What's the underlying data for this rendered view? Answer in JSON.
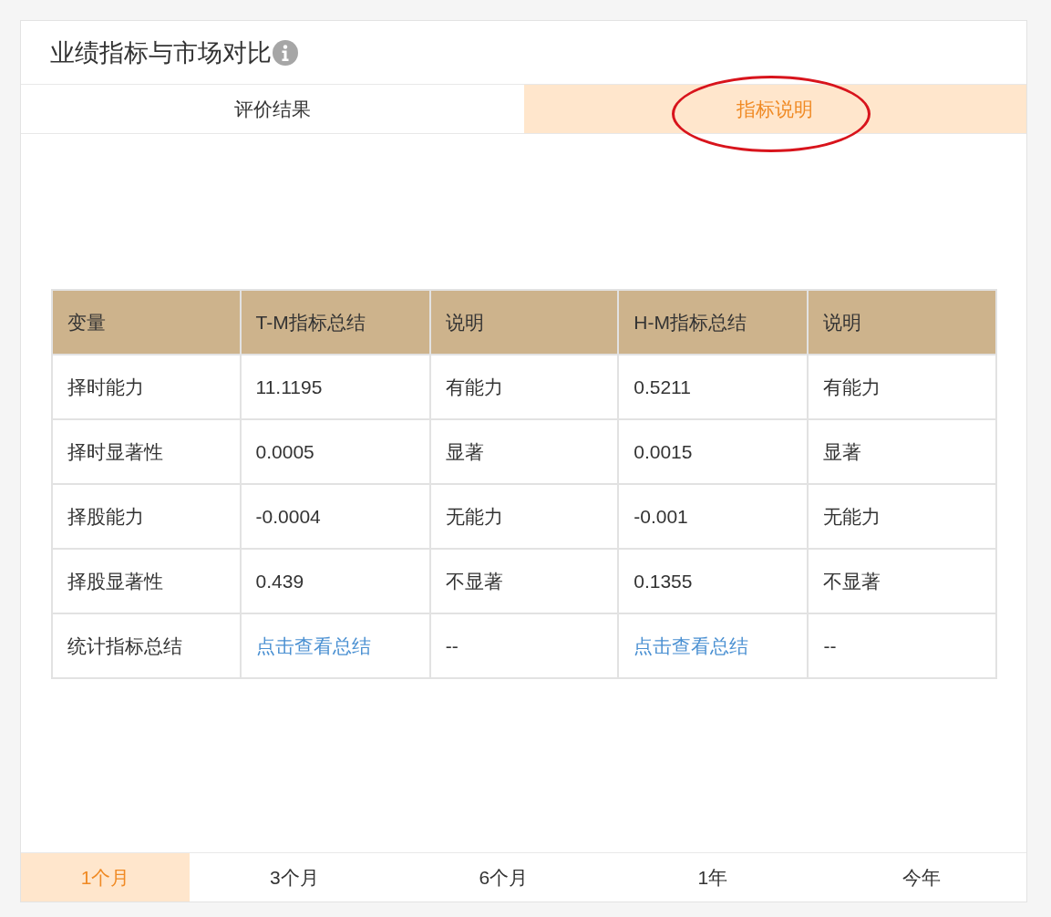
{
  "panel": {
    "title": "业绩指标与市场对比",
    "info_icon": true
  },
  "tabs": [
    {
      "label": "评价结果",
      "selected": false,
      "circled": false
    },
    {
      "label": "指标说明",
      "selected": true,
      "circled": true
    }
  ],
  "table": {
    "columns": [
      "变量",
      "T-M指标总结",
      "说明",
      "H-M指标总结",
      "说明"
    ],
    "rows": [
      [
        {
          "text": "择时能力",
          "kind": "text"
        },
        {
          "text": "11.1195",
          "kind": "text"
        },
        {
          "text": "有能力",
          "kind": "text"
        },
        {
          "text": "0.5211",
          "kind": "text"
        },
        {
          "text": "有能力",
          "kind": "text"
        }
      ],
      [
        {
          "text": "择时显著性",
          "kind": "text"
        },
        {
          "text": "0.0005",
          "kind": "text"
        },
        {
          "text": "显著",
          "kind": "text"
        },
        {
          "text": "0.0015",
          "kind": "text"
        },
        {
          "text": "显著",
          "kind": "text"
        }
      ],
      [
        {
          "text": "择股能力",
          "kind": "text"
        },
        {
          "text": "-0.0004",
          "kind": "text"
        },
        {
          "text": "无能力",
          "kind": "text"
        },
        {
          "text": "-0.001",
          "kind": "text"
        },
        {
          "text": "无能力",
          "kind": "text"
        }
      ],
      [
        {
          "text": "择股显著性",
          "kind": "text"
        },
        {
          "text": "0.439",
          "kind": "text"
        },
        {
          "text": "不显著",
          "kind": "text"
        },
        {
          "text": "0.1355",
          "kind": "text"
        },
        {
          "text": "不显著",
          "kind": "text"
        }
      ],
      [
        {
          "text": "统计指标总结",
          "kind": "text"
        },
        {
          "text": "点击查看总结",
          "kind": "link"
        },
        {
          "text": "--",
          "kind": "text"
        },
        {
          "text": "点击查看总结",
          "kind": "link"
        },
        {
          "text": "--",
          "kind": "text"
        }
      ]
    ]
  },
  "periods": [
    {
      "label": "1个月",
      "selected": true
    },
    {
      "label": "3个月",
      "selected": false
    },
    {
      "label": "6个月",
      "selected": false
    },
    {
      "label": "1年",
      "selected": false
    },
    {
      "label": "今年",
      "selected": false
    }
  ]
}
